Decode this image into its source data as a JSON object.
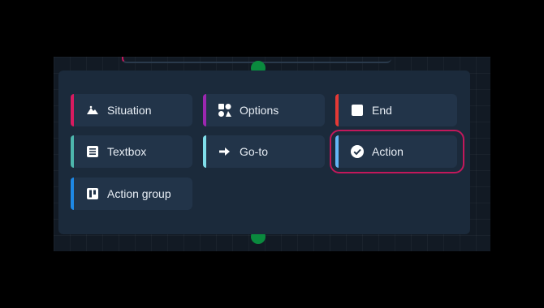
{
  "colors": {
    "situation": "#d81b60",
    "options": "#9c27b0",
    "end": "#e53935",
    "textbox": "#4db6ac",
    "goto": "#80deea",
    "action": "#64b5f6",
    "action_group": "#1e88e5",
    "selection": "#c2185b",
    "connector": "#0a8a3e"
  },
  "menu": {
    "items": [
      {
        "label": "Situation",
        "icon": "landscape-icon"
      },
      {
        "label": "Options",
        "icon": "shapes-icon"
      },
      {
        "label": "End",
        "icon": "stop-square-icon"
      },
      {
        "label": "Textbox",
        "icon": "text-box-icon"
      },
      {
        "label": "Go-to",
        "icon": "arrow-right-icon"
      },
      {
        "label": "Action",
        "icon": "check-circle-icon",
        "selected": true
      },
      {
        "label": "Action group",
        "icon": "board-icon"
      }
    ]
  }
}
